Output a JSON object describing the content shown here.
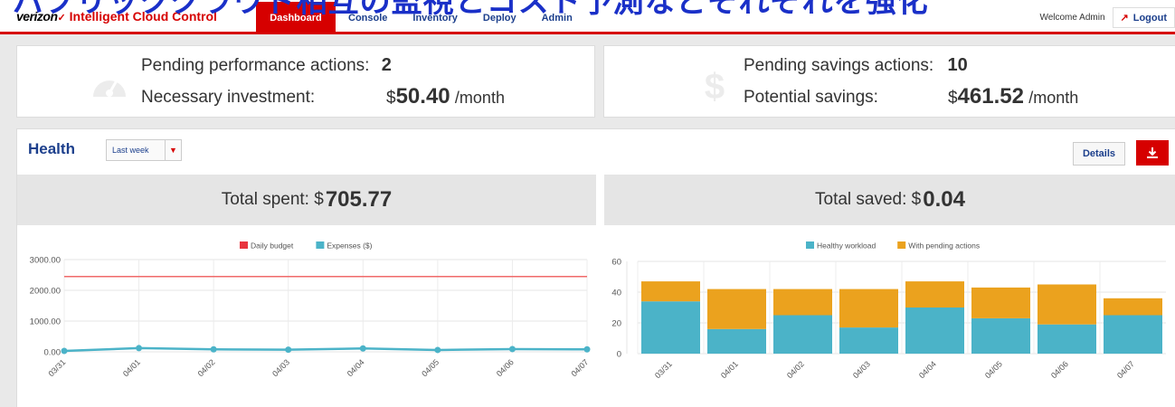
{
  "overlay": {
    "caption": "パブリッククラウド相互の監視とコスト予測などそれぞれを強化"
  },
  "brand": {
    "logo": "verizon",
    "logo_mark": "✓",
    "app_name": "Intelligent Cloud Control"
  },
  "nav": {
    "tabs": [
      {
        "label": "Dashboard",
        "active": true
      },
      {
        "label": "Console",
        "active": false
      },
      {
        "label": "Inventory",
        "active": false
      },
      {
        "label": "Deploy",
        "active": false
      },
      {
        "label": "Admin",
        "active": false
      }
    ]
  },
  "user": {
    "welcome": "Welcome Admin",
    "logout_label": "Logout"
  },
  "summary": {
    "performance": {
      "pending_label": "Pending performance actions:",
      "pending_value": "2",
      "investment_label": "Necessary investment:",
      "currency": "$",
      "investment_value": "50.40",
      "unit": "/month"
    },
    "savings": {
      "pending_label": "Pending savings actions:",
      "pending_value": "10",
      "savings_label": "Potential savings:",
      "currency": "$",
      "savings_value": "461.52",
      "unit": "/month"
    }
  },
  "health": {
    "title": "Health",
    "range_selected": "Last week",
    "details_label": "Details",
    "total_spent_label": "Total spent: $",
    "total_spent_value": "705.77",
    "total_saved_label": "Total saved: $",
    "total_saved_value": "0.04"
  },
  "colors": {
    "accent": "#d60000",
    "nav_text": "#1c3f8c",
    "teal": "#4bb3c8",
    "orange": "#eba21e",
    "budget_line": "#f06a6a"
  },
  "chart_data": [
    {
      "type": "line",
      "legend": [
        "Daily budget",
        "Expenses ($)"
      ],
      "x": [
        "03/31",
        "04/01",
        "04/02",
        "04/03",
        "04/04",
        "04/05",
        "04/06",
        "04/07"
      ],
      "y_ticks": [
        "3000.00",
        "2000.00",
        "1000.00",
        "0.00"
      ],
      "ylim": [
        0,
        3000
      ],
      "series": [
        {
          "name": "Daily budget",
          "values": [
            2450,
            2450,
            2450,
            2450,
            2450,
            2450,
            2450,
            2450
          ]
        },
        {
          "name": "Expenses ($)",
          "values": [
            30,
            120,
            80,
            70,
            110,
            60,
            90,
            80
          ]
        }
      ],
      "grid": true,
      "legend_position": "top-center"
    },
    {
      "type": "bar",
      "stacked": true,
      "legend": [
        "Healthy workload",
        "With pending actions"
      ],
      "categories": [
        "03/31",
        "04/01",
        "04/02",
        "04/03",
        "04/04",
        "04/05",
        "04/06",
        "04/07"
      ],
      "y_ticks": [
        "60",
        "40",
        "20",
        "0"
      ],
      "ylim": [
        0,
        60
      ],
      "series": [
        {
          "name": "Healthy workload",
          "values": [
            34,
            16,
            25,
            17,
            30,
            23,
            19,
            25
          ]
        },
        {
          "name": "With pending actions",
          "values": [
            13,
            26,
            17,
            25,
            17,
            20,
            26,
            11
          ]
        }
      ],
      "grid": true,
      "legend_position": "top-center"
    }
  ]
}
